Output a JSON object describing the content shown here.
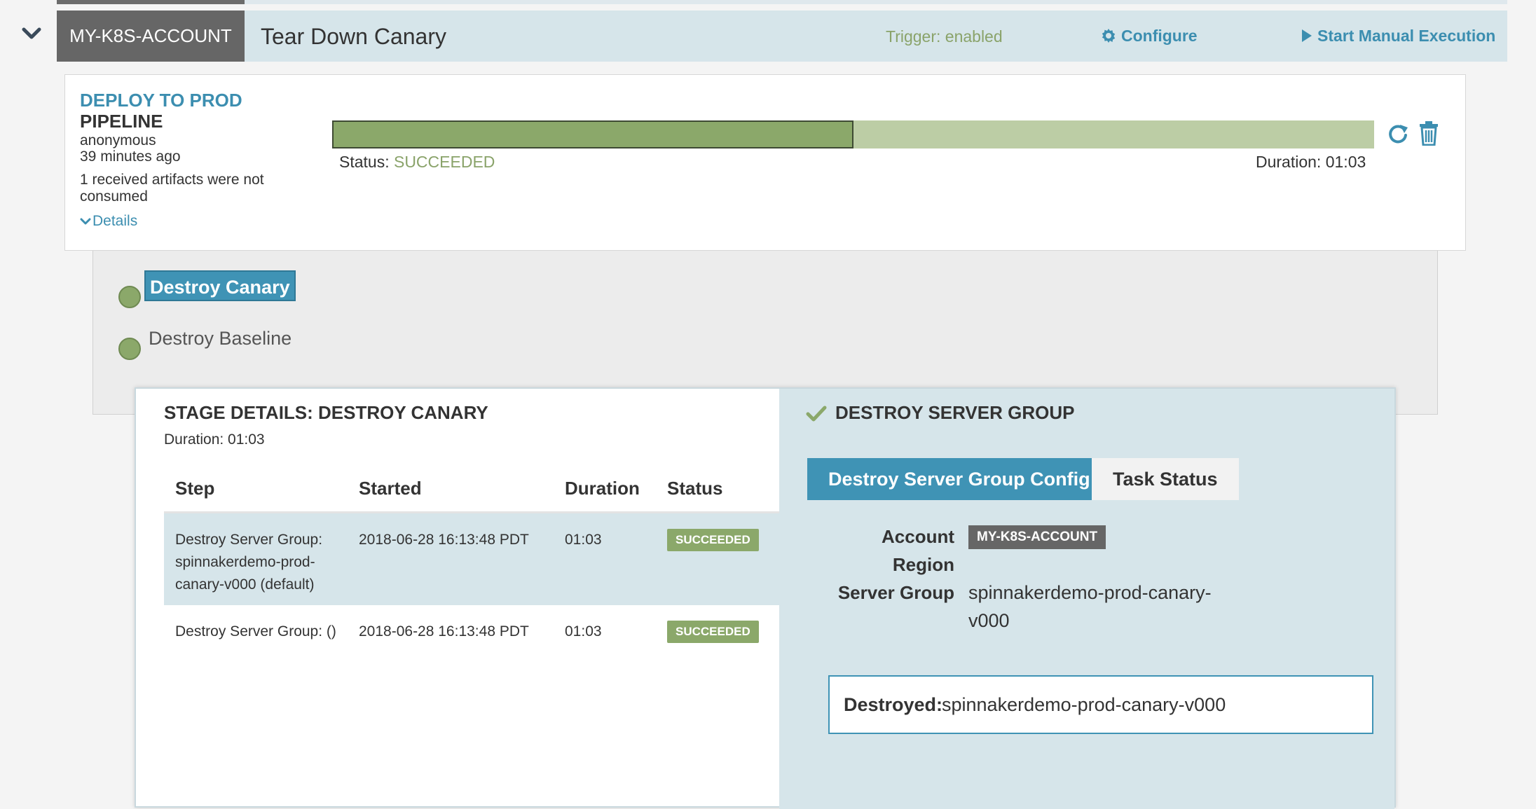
{
  "header": {
    "account": "MY-K8S-ACCOUNT",
    "pipeline_name": "Tear Down Canary",
    "trigger_status": "Trigger: enabled",
    "configure_label": "Configure",
    "start_manual_label": "Start Manual Execution"
  },
  "execution": {
    "trigger_name": "DEPLOY TO PROD",
    "trigger_type": "PIPELINE",
    "user": "anonymous",
    "time_ago": "39 minutes ago",
    "artifact_note": "1 received artifacts were not consumed",
    "details_label": "Details",
    "status_label": "Status: ",
    "status_value": "SUCCEEDED",
    "duration": "Duration: 01:03",
    "progress_fraction": 0.5
  },
  "stages": [
    {
      "label": "Destroy Canary",
      "selected": true
    },
    {
      "label": "Destroy Baseline",
      "selected": false
    }
  ],
  "stage_details": {
    "title": "STAGE DETAILS: DESTROY CANARY",
    "duration": "Duration: 01:03",
    "columns": [
      "Step",
      "Started",
      "Duration",
      "Status"
    ],
    "rows": [
      {
        "step": "Destroy Server Group: spinnakerdemo-prod-canary-v000 (default)",
        "started": "2018-06-28 16:13:48 PDT",
        "duration": "01:03",
        "status": "SUCCEEDED"
      },
      {
        "step": "Destroy Server Group: ()",
        "started": "2018-06-28 16:13:48 PDT",
        "duration": "01:03",
        "status": "SUCCEEDED"
      }
    ]
  },
  "task": {
    "title": "DESTROY SERVER GROUP",
    "tabs": [
      "Destroy Server Group Config",
      "Task Status"
    ],
    "fields": {
      "account_key": "Account",
      "account_value": "MY-K8S-ACCOUNT",
      "region_key": "Region",
      "server_group_key": "Server Group",
      "server_group_value": "spinnakerdemo-prod-canary-v000"
    },
    "destroyed_label": "Destroyed:",
    "destroyed_value": "spinnakerdemo-prod-canary-v000"
  },
  "icons": {
    "collapse": "chevron-down-icon",
    "configure": "gear-icon",
    "start": "play-icon",
    "rerun": "refresh-icon",
    "delete": "trash-icon",
    "details": "chevron-down-icon",
    "task_done": "check-icon"
  },
  "colors": {
    "accent": "#3f93b5",
    "success": "#8ba86a",
    "header_bg": "#d6e5ea",
    "account_tag": "#666666"
  }
}
